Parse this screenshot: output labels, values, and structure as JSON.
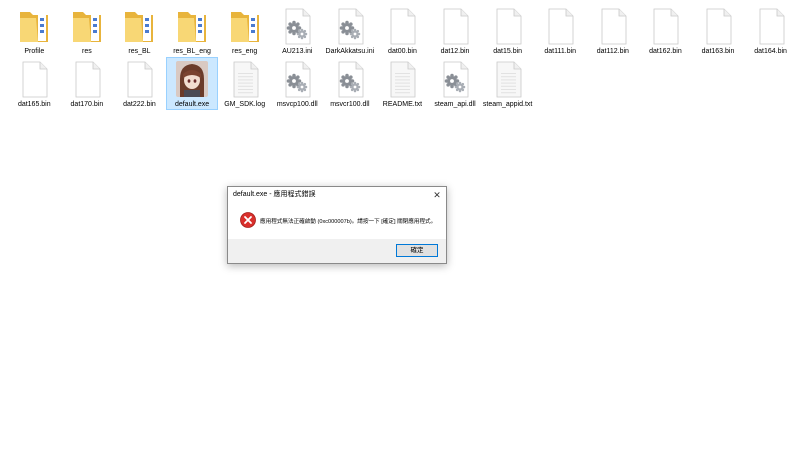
{
  "files": [
    {
      "name": "Profile",
      "icon": "folder-icon"
    },
    {
      "name": "res",
      "icon": "folder-icon"
    },
    {
      "name": "res_BL",
      "icon": "folder-icon"
    },
    {
      "name": "res_BL_eng",
      "icon": "folder-icon"
    },
    {
      "name": "res_eng",
      "icon": "folder-icon"
    },
    {
      "name": "AU213.ini",
      "icon": "settings-file-icon"
    },
    {
      "name": "DarkAkkatsu.ini",
      "icon": "settings-file-icon"
    },
    {
      "name": "dat00.bin",
      "icon": "blank-file-icon"
    },
    {
      "name": "dat12.bin",
      "icon": "blank-file-icon"
    },
    {
      "name": "dat15.bin",
      "icon": "blank-file-icon"
    },
    {
      "name": "dat111.bin",
      "icon": "blank-file-icon"
    },
    {
      "name": "dat112.bin",
      "icon": "blank-file-icon"
    },
    {
      "name": "dat162.bin",
      "icon": "blank-file-icon"
    },
    {
      "name": "dat163.bin",
      "icon": "blank-file-icon"
    },
    {
      "name": "dat164.bin",
      "icon": "blank-file-icon"
    },
    {
      "name": "dat165.bin",
      "icon": "blank-file-icon"
    },
    {
      "name": "dat170.bin",
      "icon": "blank-file-icon"
    },
    {
      "name": "dat222.bin",
      "icon": "blank-file-icon"
    },
    {
      "name": "default.exe",
      "icon": "app-character-icon",
      "selected": true
    },
    {
      "name": "GM_SDK.log",
      "icon": "text-file-icon"
    },
    {
      "name": "msvcp100.dll",
      "icon": "settings-file-icon"
    },
    {
      "name": "msvcr100.dll",
      "icon": "settings-file-icon"
    },
    {
      "name": "README.txt",
      "icon": "text-file-icon"
    },
    {
      "name": "steam_api.dll",
      "icon": "settings-file-icon"
    },
    {
      "name": "steam_appid.txt",
      "icon": "text-file-icon"
    }
  ],
  "dialog": {
    "title": "default.exe - 應用程式錯誤",
    "close_label": "✕",
    "message": "應用程式無法正確啟動 (0xc000007b)。請按一下 [確定] 關閉應用程式。",
    "ok_label": "確定",
    "icon": "error-icon"
  },
  "colors": {
    "folder": "#f8d775",
    "selection": "#cce8ff",
    "error": "#d9302c",
    "button_border": "#0078d7"
  }
}
